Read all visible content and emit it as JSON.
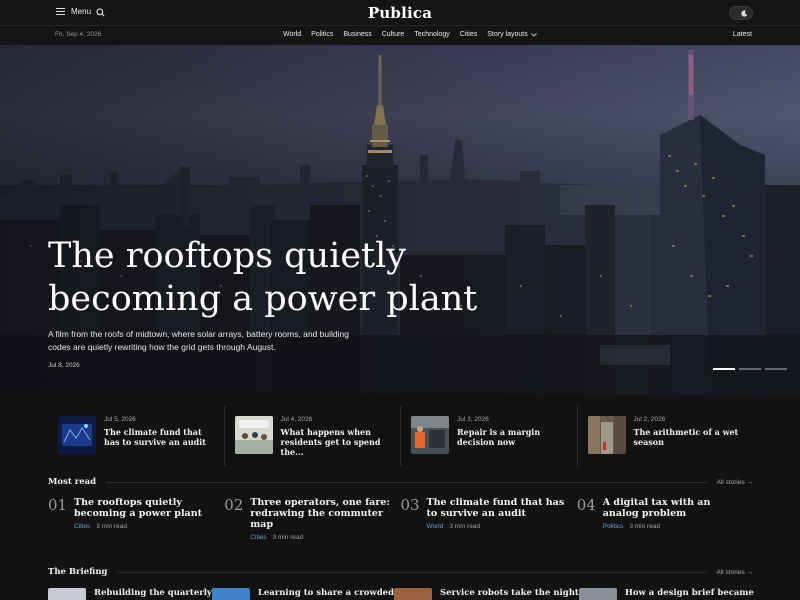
{
  "header": {
    "menu_label": "Menu",
    "logo": "Publica"
  },
  "navbar": {
    "date": "Fri, Sep 4, 2026",
    "items": [
      "World",
      "Politics",
      "Business",
      "Culture",
      "Technology",
      "Cities",
      "Story layouts"
    ],
    "latest": "Latest"
  },
  "hero": {
    "title": "The rooftops quietly becoming a power plant",
    "subtitle": "A film from the roofs of midtown, where solar arrays, battery rooms, and building codes are quietly rewriting how the grid gets through August.",
    "date": "Jul 8, 2026",
    "slides": 3,
    "active_slide": 1
  },
  "cards": [
    {
      "date": "Jul 5, 2026",
      "title": "The climate fund that has to survive an audit"
    },
    {
      "date": "Jul 4, 2026",
      "title": "What happens when residents get to spend the..."
    },
    {
      "date": "Jul 3, 2026",
      "title": "Repair is a margin decision now"
    },
    {
      "date": "Jul 2, 2026",
      "title": "The arithmetic of a wet season"
    }
  ],
  "most_read": {
    "heading": "Most read",
    "all_label": "All stories →",
    "items": [
      {
        "num": "01",
        "title": "The rooftops quietly becoming a power plant",
        "category": "Cities",
        "read": "3 min read"
      },
      {
        "num": "02",
        "title": "Three operators, one fare: redrawing the commuter map",
        "category": "Cities",
        "read": "3 min read"
      },
      {
        "num": "03",
        "title": "The climate fund that has to survive an audit",
        "category": "World",
        "read": "3 min read"
      },
      {
        "num": "04",
        "title": "A digital tax with an analog problem",
        "category": "Politics",
        "read": "3 min read"
      }
    ]
  },
  "briefing": {
    "heading": "The Briefing",
    "all_label": "All stories →",
    "items": [
      {
        "title": "Rebuilding the quarterly"
      },
      {
        "title": "Learning to share a crowded"
      },
      {
        "title": "Service robots take the night"
      },
      {
        "title": "How a design brief became"
      }
    ]
  },
  "colors": {
    "background": "#121212",
    "accent_category": "#6f9fd8"
  }
}
